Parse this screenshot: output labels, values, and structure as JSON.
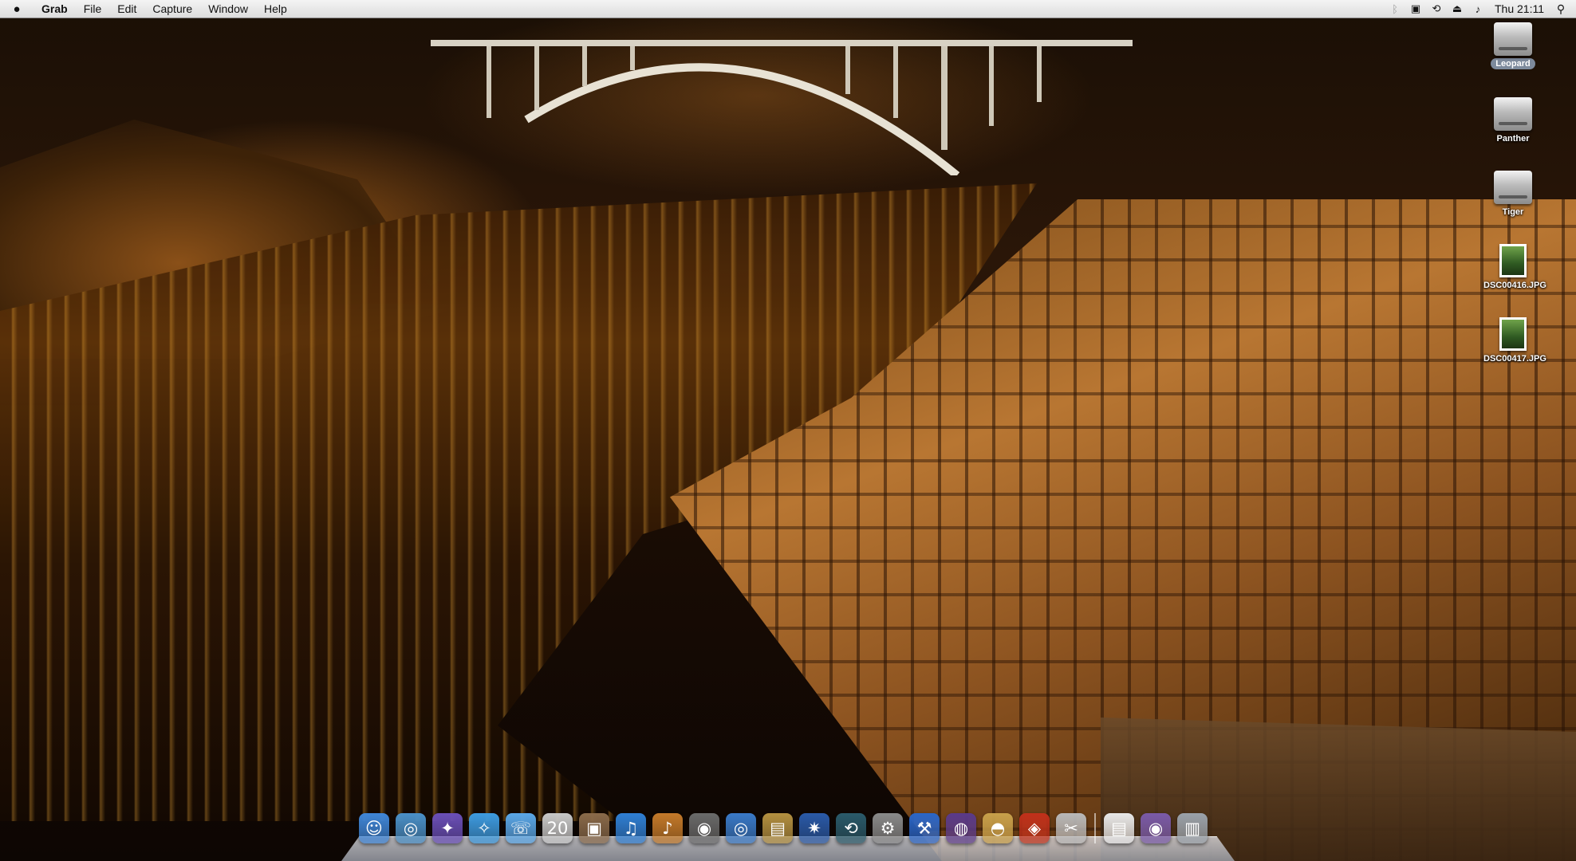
{
  "menubar": {
    "apple_icon": "apple-icon",
    "app_name": "Grab",
    "menus": [
      "File",
      "Edit",
      "Capture",
      "Window",
      "Help"
    ],
    "status_icons": [
      "bluetooth-icon",
      "display-icon",
      "time-machine-icon",
      "eject-icon",
      "volume-icon"
    ],
    "clock": "Thu 21:11",
    "spotlight_icon": "spotlight-icon"
  },
  "desktop_icons": [
    {
      "label": "Leopard",
      "kind": "disk",
      "selected": true
    },
    {
      "label": "Panther",
      "kind": "disk",
      "selected": false
    },
    {
      "label": "Tiger",
      "kind": "disk",
      "selected": false
    },
    {
      "label": "DSC00416.JPG",
      "kind": "image",
      "selected": false
    },
    {
      "label": "DSC00417.JPG",
      "kind": "image",
      "selected": false
    }
  ],
  "dock": {
    "apps": [
      {
        "name": "finder-icon",
        "color": "#3f86d8",
        "glyph": "☺"
      },
      {
        "name": "dashboard-icon",
        "color": "#4a90c8",
        "glyph": "◎"
      },
      {
        "name": "ical-palette-icon",
        "color": "#6a4fb8",
        "glyph": "✦"
      },
      {
        "name": "safari-icon",
        "color": "#3d9be0",
        "glyph": "✧"
      },
      {
        "name": "ichat-icon",
        "color": "#5aa7e8",
        "glyph": "☏"
      },
      {
        "name": "ical-icon",
        "color": "#c8c8c8",
        "glyph": "20"
      },
      {
        "name": "preview-icon",
        "color": "#8a6a4a",
        "glyph": "▣"
      },
      {
        "name": "itunes-icon",
        "color": "#2f7fd4",
        "glyph": "♫"
      },
      {
        "name": "garageband-icon",
        "color": "#c47a2a",
        "glyph": "♪"
      },
      {
        "name": "photo-booth-icon",
        "color": "#6a6a6a",
        "glyph": "◉"
      },
      {
        "name": "dvd-player-icon",
        "color": "#3a7ac8",
        "glyph": "◎"
      },
      {
        "name": "iphoto-icon",
        "color": "#b49040",
        "glyph": "▤"
      },
      {
        "name": "imovie-icon",
        "color": "#2a5aa8",
        "glyph": "✷"
      },
      {
        "name": "time-machine-icon",
        "color": "#2a5a6a",
        "glyph": "⟲"
      },
      {
        "name": "system-preferences-icon",
        "color": "#8a8a8a",
        "glyph": "⚙"
      },
      {
        "name": "xcode-icon",
        "color": "#2a66c8",
        "glyph": "⚒"
      },
      {
        "name": "spaces-icon",
        "color": "#5a3a8a",
        "glyph": "◍"
      },
      {
        "name": "network-globe-icon",
        "color": "#c8a04a",
        "glyph": "◓"
      },
      {
        "name": "front-row-icon",
        "color": "#c0301a",
        "glyph": "◈"
      },
      {
        "name": "grab-icon",
        "color": "#b8b8b8",
        "glyph": "✂"
      }
    ],
    "stacks": [
      {
        "name": "documents-stack-icon",
        "color": "#e8e8e8",
        "glyph": "▤"
      },
      {
        "name": "downloads-stack-icon",
        "color": "#7a5aa8",
        "glyph": "◉"
      },
      {
        "name": "trash-icon",
        "color": "#9aa2aa",
        "glyph": "▥"
      }
    ]
  }
}
